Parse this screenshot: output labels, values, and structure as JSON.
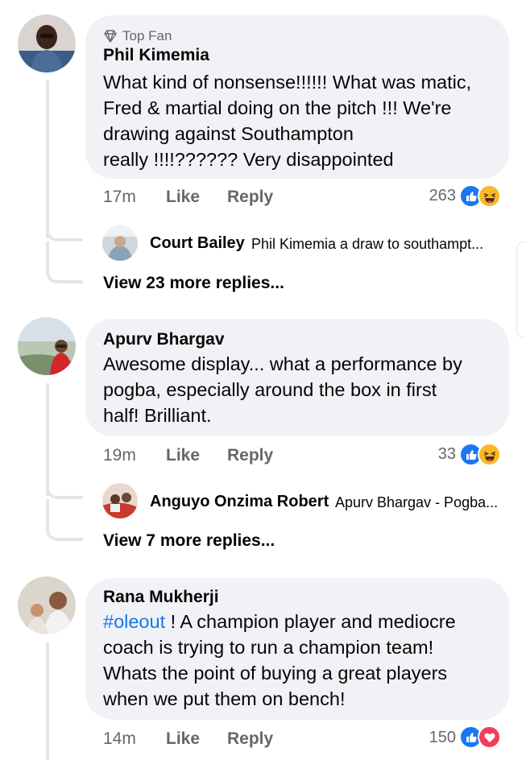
{
  "comments": [
    {
      "badge": "Top Fan",
      "author": "Phil Kimemia",
      "text_lines": [
        "What kind of nonsense!!!!!! What was matic,",
        "Fred & martial doing on the pitch !!! We're",
        "drawing against Southampton",
        "really !!!!?????? Very disappointed"
      ],
      "time": "17m",
      "like_label": "Like",
      "reply_label": "Reply",
      "reaction_count": "263",
      "reactions": [
        "like-icon",
        "haha-icon"
      ],
      "reply_preview": {
        "author": "Court Bailey",
        "text": "Phil Kimemia a draw to southampt..."
      },
      "more_replies": "View 23 more replies..."
    },
    {
      "author": "Apurv Bhargav",
      "text_lines": [
        "Awesome display... what a performance by",
        "pogba, especially around the box in first",
        "half! Brilliant."
      ],
      "time": "19m",
      "like_label": "Like",
      "reply_label": "Reply",
      "reaction_count": "33",
      "reactions": [
        "like-icon",
        "haha-icon"
      ],
      "reply_preview": {
        "author": "Anguyo Onzima Robert",
        "text": "Apurv Bhargav - Pogba..."
      },
      "more_replies": "View 7 more replies..."
    },
    {
      "author": "Rana Mukherji",
      "hashtag": "#oleout",
      "text_first_rest": " ! A champion player and mediocre",
      "text_lines": [
        "coach is trying to run a champion team!",
        "Whats the point of buying a great players",
        "when we put them on bench!"
      ],
      "time": "14m",
      "like_label": "Like",
      "reply_label": "Reply",
      "reaction_count": "150",
      "reactions": [
        "like-icon",
        "love-icon"
      ]
    }
  ],
  "colors": {
    "bubble": "#f0f2f5",
    "meta": "#65676b",
    "like_blue": "#1877f2",
    "haha_yellow": "#f7b928",
    "love_red": "#f33e58"
  }
}
